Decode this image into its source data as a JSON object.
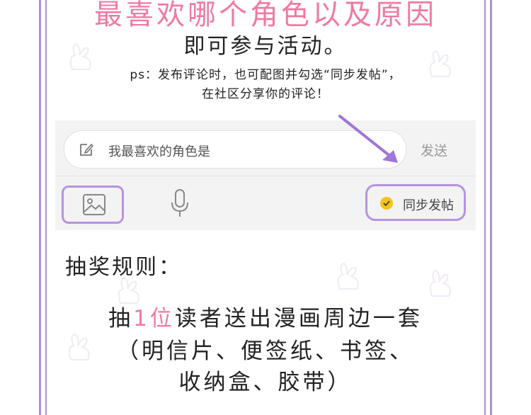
{
  "header": {
    "title": "最喜欢哪个角色以及原因",
    "subtitle": "即可参与活动。",
    "ps_line1": "ps：发布评论时，也可配图并勾选“同步发帖”，",
    "ps_line2": "在社区分享你的评论！"
  },
  "comment_bar": {
    "placeholder": "我最喜欢的角色是",
    "send_label": "发送"
  },
  "toolbar": {
    "sync_label": "同步发帖"
  },
  "rules": {
    "heading": "抽奖规则：",
    "line1_prefix": "抽",
    "line1_highlight": "1位",
    "line1_suffix": "读者送出漫画周边一套",
    "line2": "（明信片、便签纸、书签、",
    "line3": "收纳盒、胶带）"
  },
  "colors": {
    "accent_pink": "#f07aa3",
    "accent_purple": "#b693e0",
    "frame_purple": "#b08fd0",
    "check_yellow": "#f7c21b"
  },
  "icons": [
    "edit-icon",
    "arrow-icon",
    "image-icon",
    "microphone-icon",
    "check-icon",
    "bunny-watermark"
  ]
}
